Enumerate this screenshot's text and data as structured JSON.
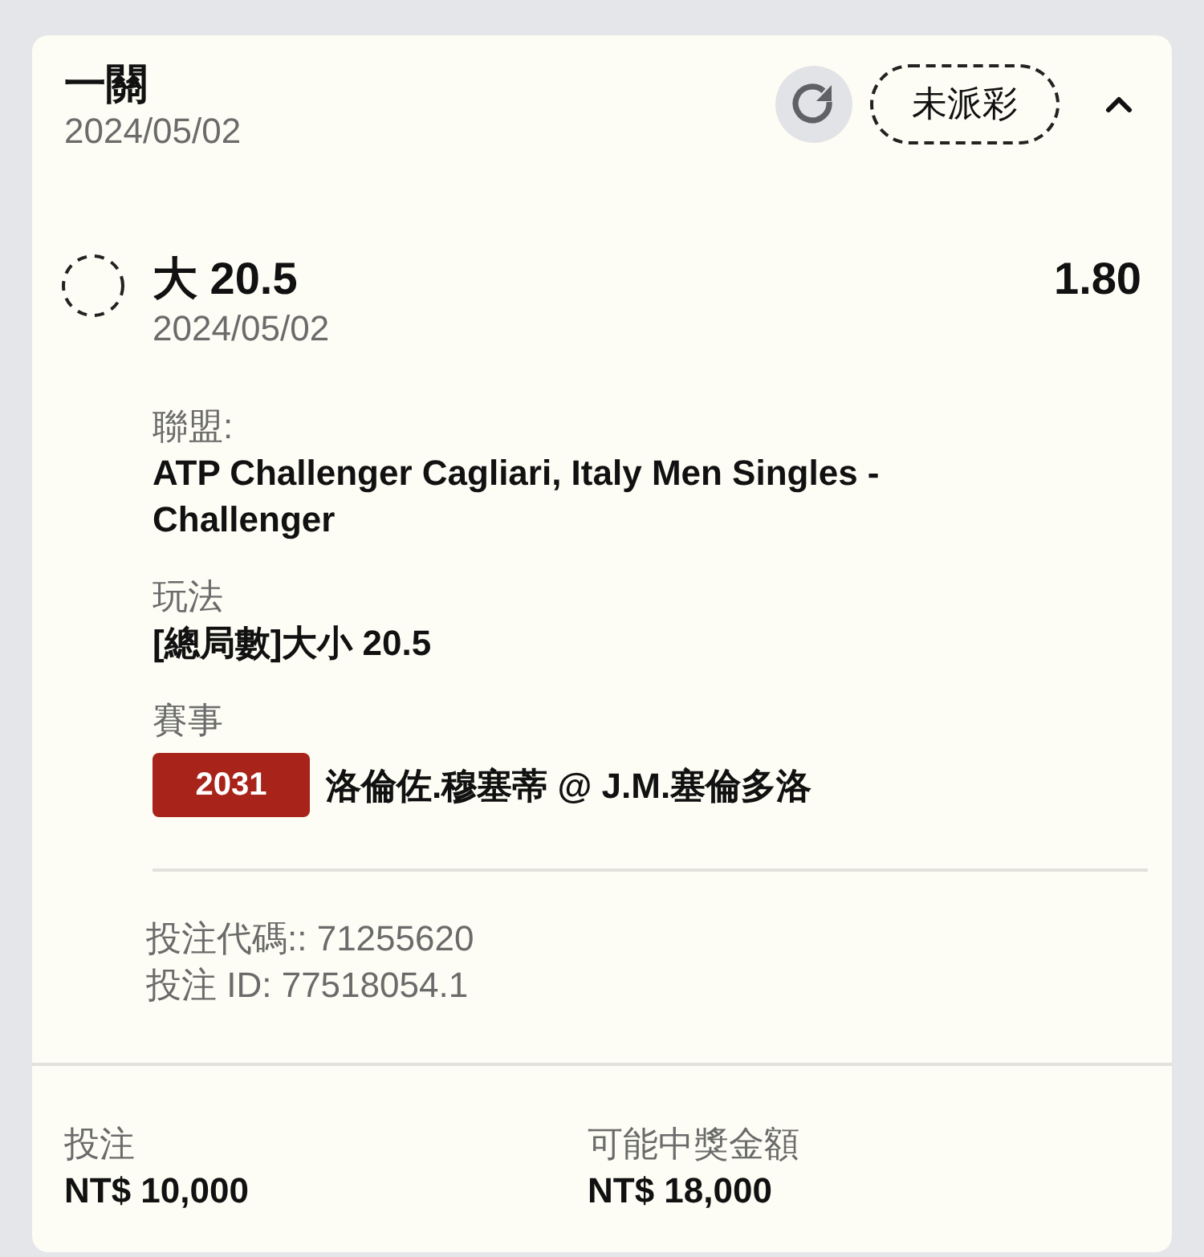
{
  "bet": {
    "title": "一關",
    "date": "2024/05/02",
    "status": "未派彩",
    "expanded": true
  },
  "selection": {
    "name": "大 20.5",
    "odds": "1.80",
    "date": "2024/05/02",
    "details": [
      {
        "kind": "text",
        "label": "聯盟:",
        "value": "ATP Challenger Cagliari, Italy Men Singles - Challenger"
      },
      {
        "kind": "text",
        "label": "玩法",
        "value": "[總局數]大小 20.5"
      },
      {
        "kind": "match",
        "label": "賽事",
        "badge": "2031",
        "value": "洛倫佐.穆塞蒂 @ J.M.塞倫多洛"
      }
    ]
  },
  "references": [
    "投注代碼:: 71255620",
    "投注 ID: 77518054.1"
  ],
  "summary": [
    {
      "label": "投注",
      "value": "NT$ 10,000"
    },
    {
      "label": "可能中獎金額",
      "value": "NT$ 18,000"
    }
  ]
}
